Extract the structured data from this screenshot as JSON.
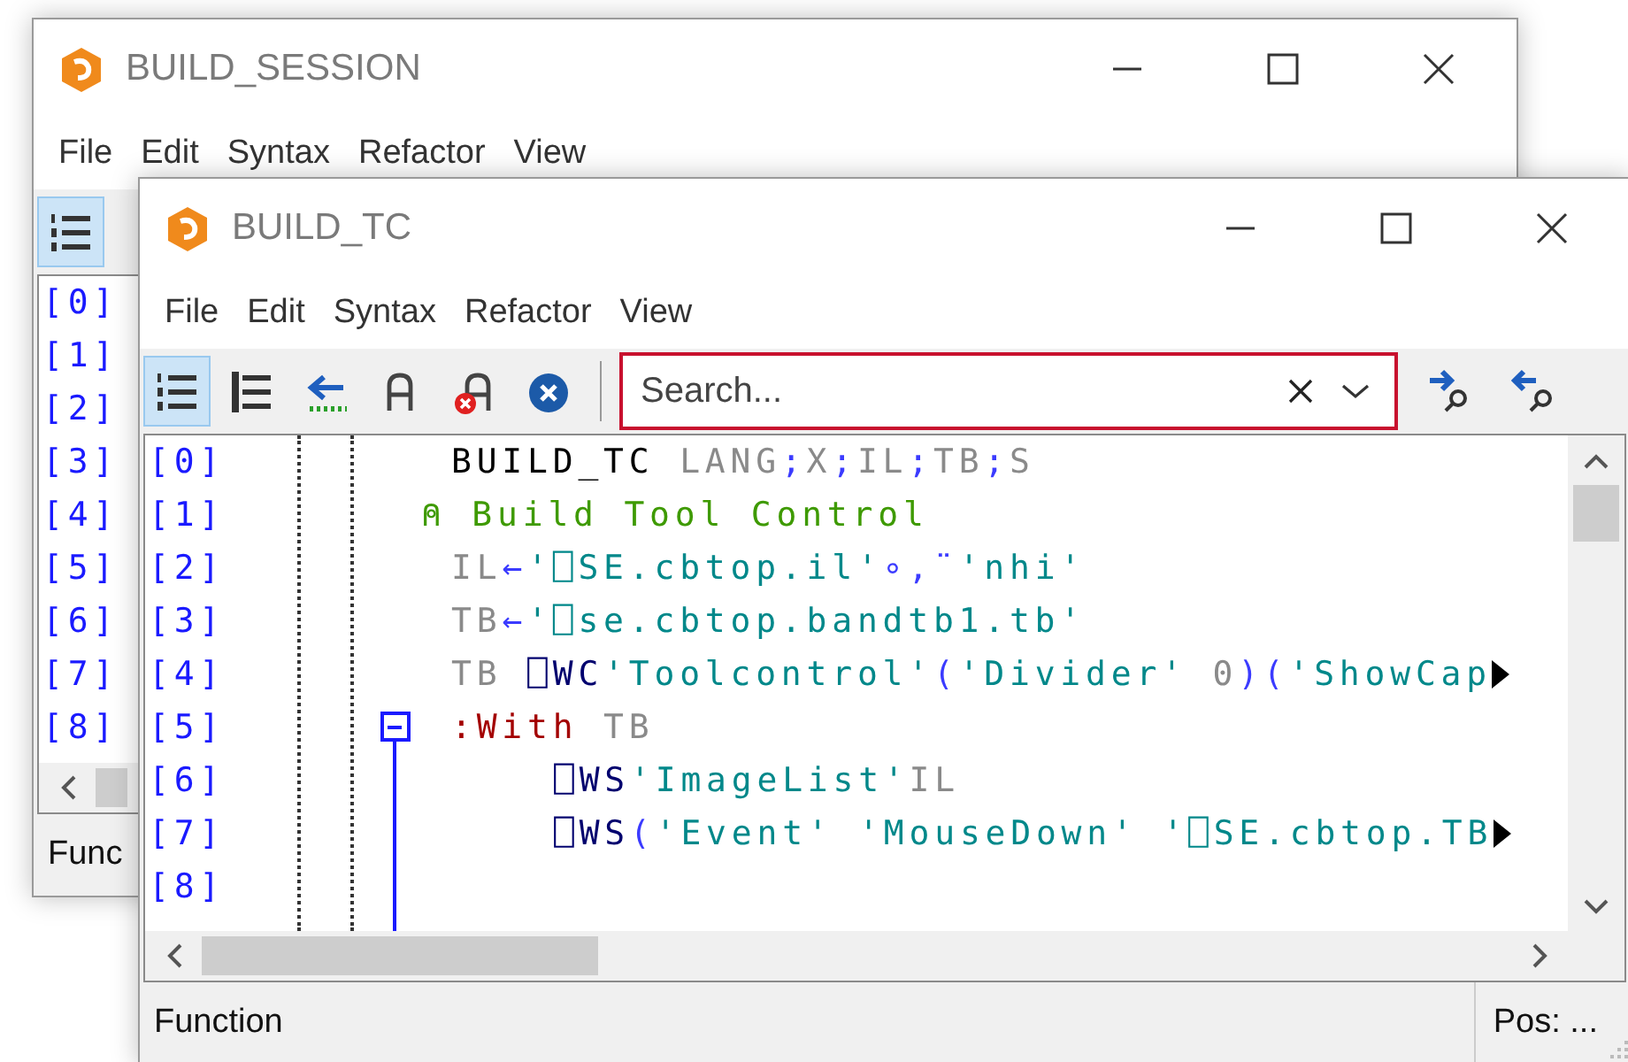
{
  "windows": [
    {
      "title": "BUILD_SESSION",
      "menu": [
        "File",
        "Edit",
        "Syntax",
        "Refactor",
        "View"
      ],
      "toolbar": [
        {
          "kind": "line-numbers",
          "selected": true
        }
      ],
      "line_numbers": [
        "[0]",
        "[1]",
        "[2]",
        "[3]",
        "[4]",
        "[5]",
        "[6]",
        "[7]",
        "[8]"
      ],
      "status_bar": {
        "left": "Func"
      }
    },
    {
      "title": "BUILD_TC",
      "menu": [
        "File",
        "Edit",
        "Syntax",
        "Refactor",
        "View"
      ],
      "toolbar": [
        {
          "kind": "line-numbers",
          "selected": true
        },
        {
          "kind": "outline",
          "selected": false
        },
        {
          "kind": "back-arrow",
          "selected": false
        },
        {
          "kind": "arch",
          "selected": false
        },
        {
          "kind": "arch-remove",
          "selected": false
        },
        {
          "kind": "clear-circle",
          "selected": false
        }
      ],
      "search": {
        "placeholder": "Search..."
      },
      "search_buttons": [
        {
          "kind": "next"
        },
        {
          "kind": "previous"
        }
      ],
      "line_numbers": [
        "[0]",
        "[1]",
        "[2]",
        "[3]",
        "[4]",
        "[5]",
        "[6]",
        "[7]",
        "[8]"
      ],
      "code": [
        {
          "tokens": [
            {
              "text": "BUILD_TC ",
              "kind": "name"
            },
            {
              "text": "LANG",
              "kind": "local"
            },
            {
              "text": ";",
              "kind": "punct"
            },
            {
              "text": "X",
              "kind": "local"
            },
            {
              "text": ";",
              "kind": "punct"
            },
            {
              "text": "IL",
              "kind": "local"
            },
            {
              "text": ";",
              "kind": "punct"
            },
            {
              "text": "TB",
              "kind": "local"
            },
            {
              "text": ";",
              "kind": "punct"
            },
            {
              "text": "S",
              "kind": "local"
            }
          ],
          "overflow": false
        },
        {
          "tokens": [
            {
              "text": "⍝ Build Tool Control",
              "kind": "comment"
            }
          ],
          "overflow": false,
          "comment": true
        },
        {
          "tokens": [
            {
              "text": "IL",
              "kind": "local"
            },
            {
              "text": "←",
              "kind": "punct"
            },
            {
              "text": "'⎕SE.cbtop.il'",
              "kind": "string"
            },
            {
              "text": "∘,¨",
              "kind": "punct"
            },
            {
              "text": "'nhi'",
              "kind": "string"
            }
          ],
          "overflow": false
        },
        {
          "tokens": [
            {
              "text": "TB",
              "kind": "local"
            },
            {
              "text": "←",
              "kind": "punct"
            },
            {
              "text": "'⎕se.cbtop.bandtb1.tb'",
              "kind": "string"
            }
          ],
          "overflow": false
        },
        {
          "tokens": [
            {
              "text": "TB ",
              "kind": "local"
            },
            {
              "text": "⎕WC",
              "kind": "system"
            },
            {
              "text": "'Toolcontrol'",
              "kind": "string"
            },
            {
              "text": "(",
              "kind": "punct"
            },
            {
              "text": "'Divider' ",
              "kind": "string"
            },
            {
              "text": "0",
              "kind": "local"
            },
            {
              "text": ")(",
              "kind": "punct"
            },
            {
              "text": "'ShowCap",
              "kind": "string"
            }
          ],
          "overflow": true
        },
        {
          "tokens": [
            {
              "text": ":With",
              "kind": "keyword"
            },
            {
              "text": " TB",
              "kind": "local"
            }
          ],
          "overflow": false,
          "expanded": true,
          "children": [
            {
              "tokens": [
                {
                  "text": "⎕WS",
                  "kind": "system"
                },
                {
                  "text": "'ImageList'",
                  "kind": "string"
                },
                {
                  "text": "IL",
                  "kind": "local"
                }
              ],
              "overflow": false
            },
            {
              "tokens": [
                {
                  "text": "⎕WS",
                  "kind": "system"
                },
                {
                  "text": "(",
                  "kind": "punct"
                },
                {
                  "text": "'Event' 'MouseDown' '⎕SE.cbtop.TB",
                  "kind": "string"
                }
              ],
              "overflow": true
            }
          ]
        }
      ],
      "status_bar": {
        "left": "Function",
        "right": "Pos: ..."
      }
    }
  ]
}
